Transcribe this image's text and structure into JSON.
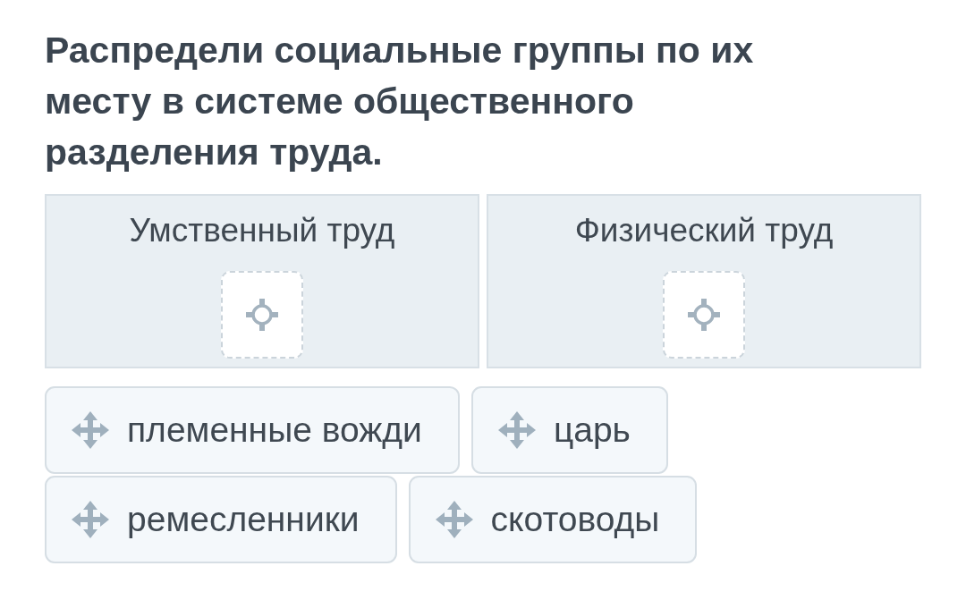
{
  "question": "Распредели социальные группы по их месту в системе общественного разделения труда.",
  "categories": [
    {
      "title": "Умственный труд"
    },
    {
      "title": "Физический труд"
    }
  ],
  "options": [
    {
      "label": "племенные вожди"
    },
    {
      "label": "царь"
    },
    {
      "label": "ремесленники"
    },
    {
      "label": "скотоводы"
    }
  ]
}
